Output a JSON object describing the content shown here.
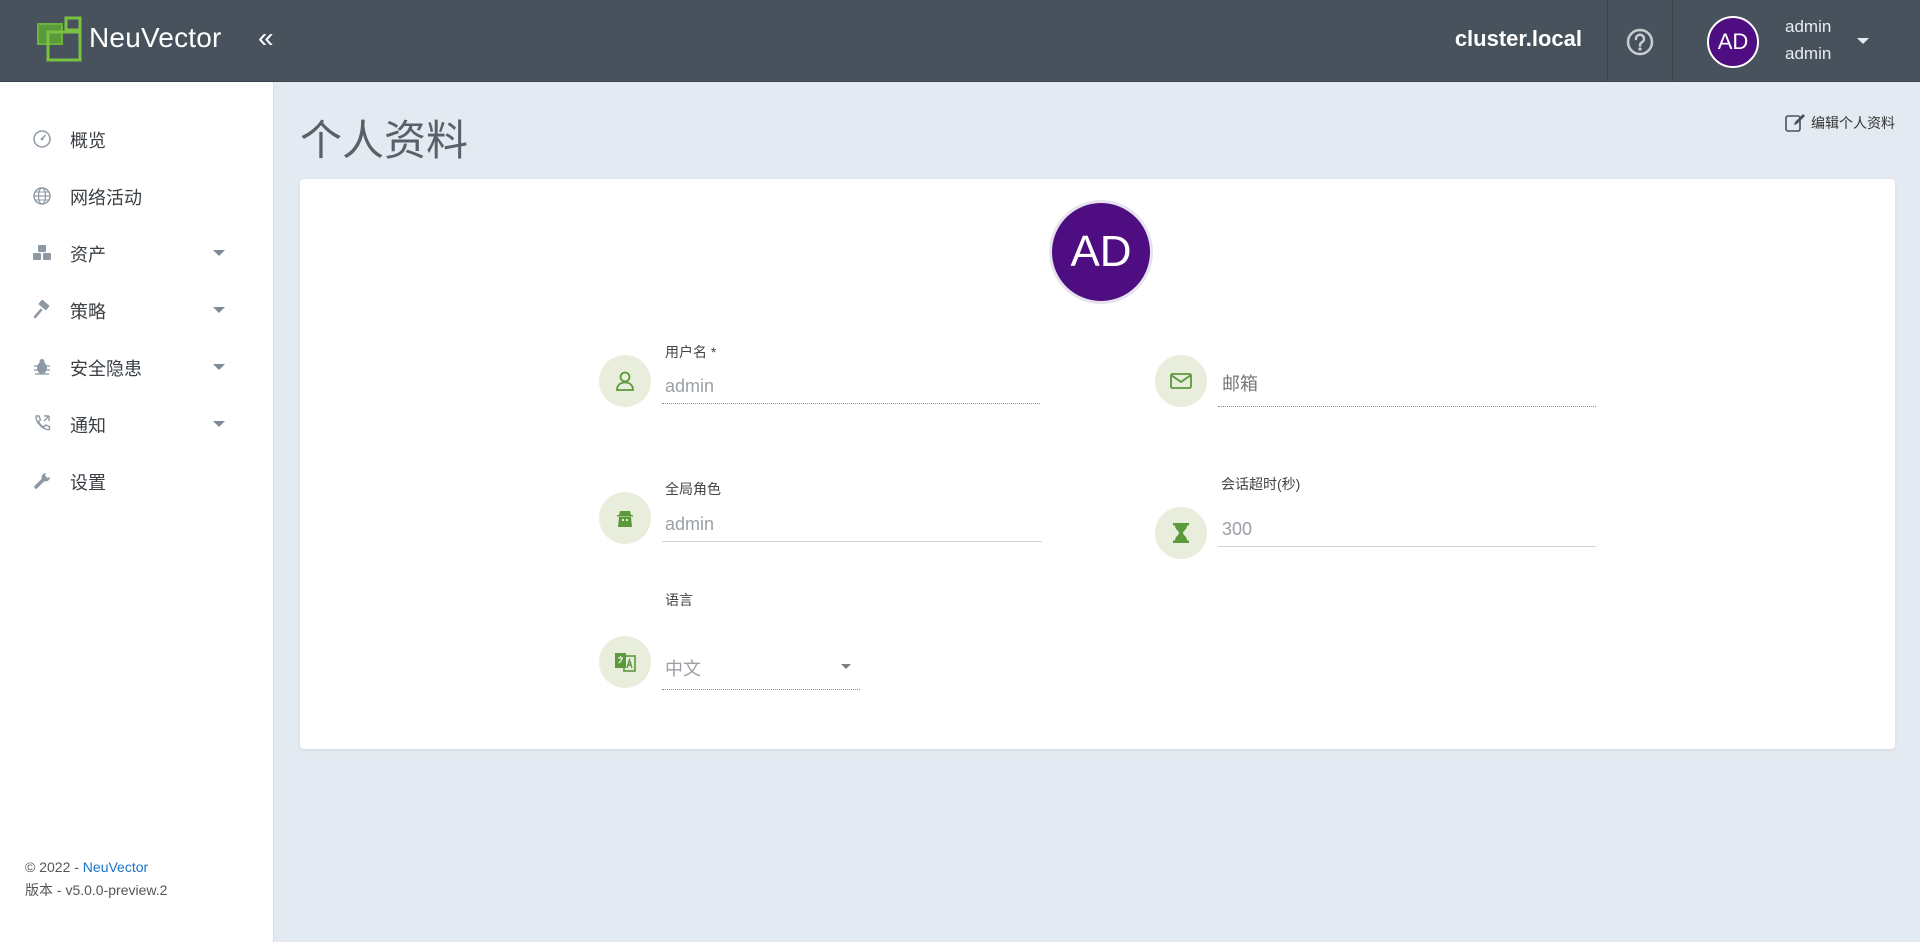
{
  "header": {
    "brand": "NeuVector",
    "collapse_glyph": "«",
    "cluster": "cluster.local",
    "avatar_initials": "AD",
    "user_name": "admin",
    "user_role": "admin"
  },
  "sidebar": {
    "items": [
      {
        "label": "概览",
        "icon": "dashboard-icon",
        "has_caret": false
      },
      {
        "label": "网络活动",
        "icon": "globe-icon",
        "has_caret": false
      },
      {
        "label": "资产",
        "icon": "cubes-icon",
        "has_caret": true
      },
      {
        "label": "策略",
        "icon": "gavel-icon",
        "has_caret": true
      },
      {
        "label": "安全隐患",
        "icon": "bug-icon",
        "has_caret": true
      },
      {
        "label": "通知",
        "icon": "phone-icon",
        "has_caret": true
      },
      {
        "label": "设置",
        "icon": "wrench-icon",
        "has_caret": false
      }
    ],
    "footer": {
      "copyright": "© 2022 - ",
      "link": "NeuVector",
      "version": "版本 - v5.0.0-preview.2"
    }
  },
  "main": {
    "title": "个人资料",
    "edit_label": "编辑个人资料",
    "avatar_initials": "AD",
    "fields": {
      "username": {
        "label": "用户名 *",
        "value": "admin",
        "icon": "user-icon"
      },
      "email": {
        "placeholder": "邮箱",
        "icon": "envelope-icon"
      },
      "global_role": {
        "label": "全局角色",
        "value": "admin",
        "icon": "agent-icon"
      },
      "timeout": {
        "label": "会话超时(秒)",
        "value": "300",
        "icon": "hourglass-icon"
      },
      "language": {
        "label": "语言",
        "value": "中文",
        "icon": "translate-icon"
      }
    }
  },
  "colors": {
    "topbar": "#48525d",
    "avatar": "#4e0d80",
    "accent_green": "#5a9a3a",
    "icon_bg": "#e8eedb",
    "link": "#1a73c9"
  }
}
